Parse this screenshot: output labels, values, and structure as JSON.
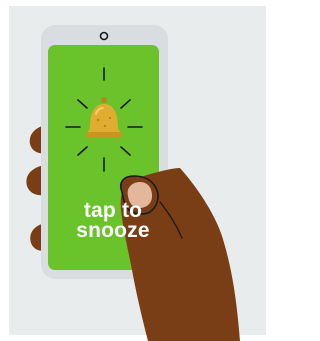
{
  "screen": {
    "line1": "tap to",
    "line2": "snooze"
  },
  "colors": {
    "background": "#e8eced",
    "phone_body": "#d9dde0",
    "screen": "#6ac32b",
    "hand": "#7a3e16",
    "thumb_nail": "#e2b79c",
    "bell": "#d9a62c",
    "rays": "#1a1a1a"
  },
  "icons": {
    "bell": "alarm-bell-icon",
    "camera": "front-camera-icon"
  }
}
